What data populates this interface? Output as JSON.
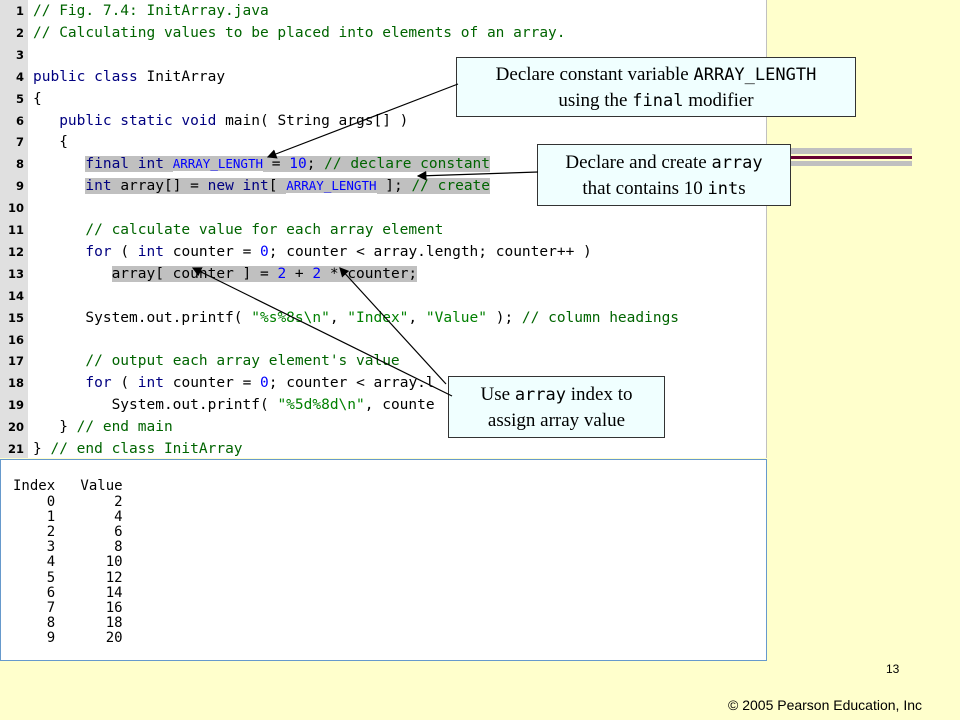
{
  "code": {
    "lines": [
      {
        "n": "1",
        "parts": [
          [
            "cm",
            "// Fig. 7.4: InitArray.java"
          ]
        ]
      },
      {
        "n": "2",
        "parts": [
          [
            "cm",
            "// Calculating values to be placed into elements of an array."
          ]
        ]
      },
      {
        "n": "3",
        "parts": []
      },
      {
        "n": "4",
        "parts": [
          [
            "kw",
            "public class"
          ],
          [
            "",
            " InitArray"
          ]
        ]
      },
      {
        "n": "5",
        "parts": [
          [
            "",
            "{"
          ]
        ]
      },
      {
        "n": "6",
        "parts": [
          [
            "",
            "   "
          ],
          [
            "kw",
            "public static void"
          ],
          [
            "",
            " main( String args[] )"
          ]
        ]
      },
      {
        "n": "7",
        "parts": [
          [
            "",
            "   {"
          ]
        ]
      },
      {
        "n": "8",
        "parts": [
          [
            "",
            "      "
          ],
          [
            "kw hl",
            "final int"
          ],
          [
            "hl",
            " "
          ],
          [
            "cst hl",
            "ARRAY_LENGTH"
          ],
          [
            "hl",
            " = "
          ],
          [
            "nm hl",
            "10"
          ],
          [
            "hl",
            "; "
          ],
          [
            "cm hl",
            "// declare constant"
          ]
        ]
      },
      {
        "n": "9",
        "parts": [
          [
            "",
            "      "
          ],
          [
            "kw hl",
            "int"
          ],
          [
            "hl",
            " array[] = "
          ],
          [
            "kw hl",
            "new int"
          ],
          [
            "hl",
            "[ "
          ],
          [
            "cst hl",
            "ARRAY_LENGTH"
          ],
          [
            "hl",
            " ]; "
          ],
          [
            "cm hl",
            "// create"
          ]
        ]
      },
      {
        "n": "10",
        "parts": []
      },
      {
        "n": "11",
        "parts": [
          [
            "",
            "      "
          ],
          [
            "cm",
            "// calculate value for each array element"
          ]
        ]
      },
      {
        "n": "12",
        "parts": [
          [
            "",
            "      "
          ],
          [
            "kw",
            "for"
          ],
          [
            "",
            " ( "
          ],
          [
            "kw",
            "int"
          ],
          [
            "",
            " counter = "
          ],
          [
            "nm",
            "0"
          ],
          [
            "",
            "; counter < array.length; counter++ )"
          ]
        ]
      },
      {
        "n": "13",
        "parts": [
          [
            "",
            "         "
          ],
          [
            "hl",
            "array[ counter ] = "
          ],
          [
            "nm hl",
            "2"
          ],
          [
            "hl",
            " + "
          ],
          [
            "nm hl",
            "2"
          ],
          [
            "hl",
            " * counter;"
          ]
        ]
      },
      {
        "n": "14",
        "parts": []
      },
      {
        "n": "15",
        "parts": [
          [
            "",
            "      System.out.printf( "
          ],
          [
            "st",
            "\"%s%8s\\n\""
          ],
          [
            "",
            ", "
          ],
          [
            "st",
            "\"Index\""
          ],
          [
            "",
            ", "
          ],
          [
            "st",
            "\"Value\""
          ],
          [
            "",
            " ); "
          ],
          [
            "cm",
            "// column headings"
          ]
        ]
      },
      {
        "n": "16",
        "parts": []
      },
      {
        "n": "17",
        "parts": [
          [
            "",
            "      "
          ],
          [
            "cm",
            "// output each array element's value"
          ]
        ]
      },
      {
        "n": "18",
        "parts": [
          [
            "",
            "      "
          ],
          [
            "kw",
            "for"
          ],
          [
            "",
            " ( "
          ],
          [
            "kw",
            "int"
          ],
          [
            "",
            " counter = "
          ],
          [
            "nm",
            "0"
          ],
          [
            "",
            "; counter < array.l"
          ]
        ]
      },
      {
        "n": "19",
        "parts": [
          [
            "",
            "         System.out.printf( "
          ],
          [
            "st",
            "\"%5d%8d\\n\""
          ],
          [
            "",
            ", counte"
          ]
        ]
      },
      {
        "n": "20",
        "parts": [
          [
            "",
            "   } "
          ],
          [
            "cm",
            "// end main"
          ]
        ]
      },
      {
        "n": "21",
        "parts": [
          [
            "",
            "} "
          ],
          [
            "cm",
            "// end class InitArray"
          ]
        ]
      }
    ]
  },
  "output": {
    "header": "Index   Value",
    "rows": [
      "    0       2",
      "    1       4",
      "    2       6",
      "    3       8",
      "    4      10",
      "    5      12",
      "    6      14",
      "    7      16",
      "    8      18",
      "    9      20"
    ]
  },
  "callouts": {
    "c1": {
      "t1": "Declare constant variable ",
      "code1": "ARRAY_LENGTH",
      "t2": "using the ",
      "code2": "final",
      "t3": " modifier"
    },
    "c2": {
      "t1": "Declare and create ",
      "code1": "array",
      "t2": "that contains 10 ",
      "code2": "int",
      "t3": "s"
    },
    "c3": {
      "t1": "Use ",
      "code1": "array",
      "t2": " index to",
      "t3": "assign array value"
    }
  },
  "footer": {
    "page_number": "13",
    "copyright": "© 2005 Pearson Education, Inc"
  },
  "colors": {
    "background": "#ffffcc",
    "callout_fill": "#f0ffff",
    "keyword": "#000080",
    "comment": "#006400",
    "highlight": "#c0c0c0",
    "stripe_dark": "#660033"
  }
}
